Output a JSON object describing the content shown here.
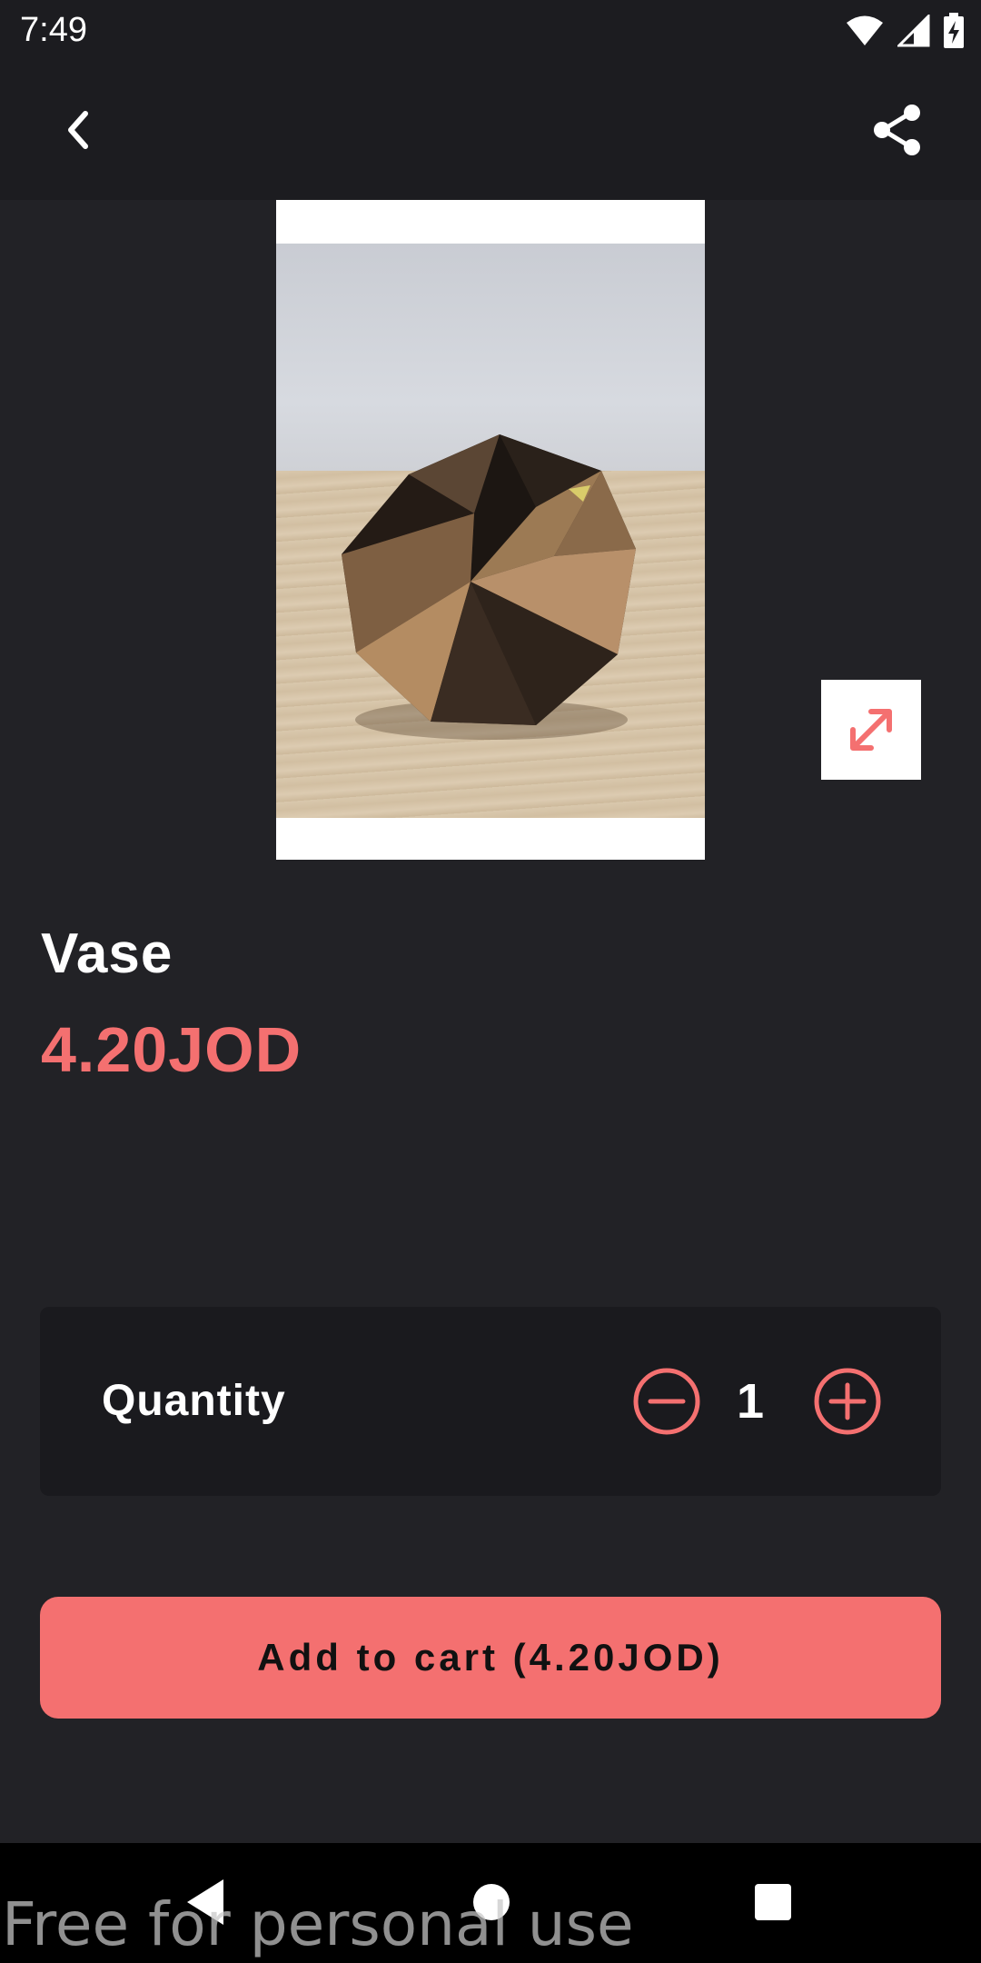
{
  "status_bar": {
    "time": "7:49",
    "icons": [
      "wifi-icon",
      "signal-icon",
      "battery-charging-icon"
    ]
  },
  "app_bar": {
    "back_icon": "chevron-left-icon",
    "share_icon": "share-icon"
  },
  "product": {
    "image_alt": "Vase",
    "expand_icon": "expand-diagonal-icon",
    "name": "Vase",
    "price": "4.20JOD"
  },
  "quantity": {
    "label": "Quantity",
    "value": "1",
    "decrement_icon": "minus-circle-icon",
    "increment_icon": "plus-circle-icon"
  },
  "cart": {
    "button_label": "Add to cart (4.20JOD)"
  },
  "system_nav": {
    "icons": [
      "nav-back-icon",
      "nav-home-icon",
      "nav-recents-icon"
    ]
  },
  "watermark": "Free for personal use",
  "colors": {
    "accent": "#f47070",
    "background": "#222226",
    "app_bar": "#1c1c20",
    "card": "#1a1a1e"
  }
}
